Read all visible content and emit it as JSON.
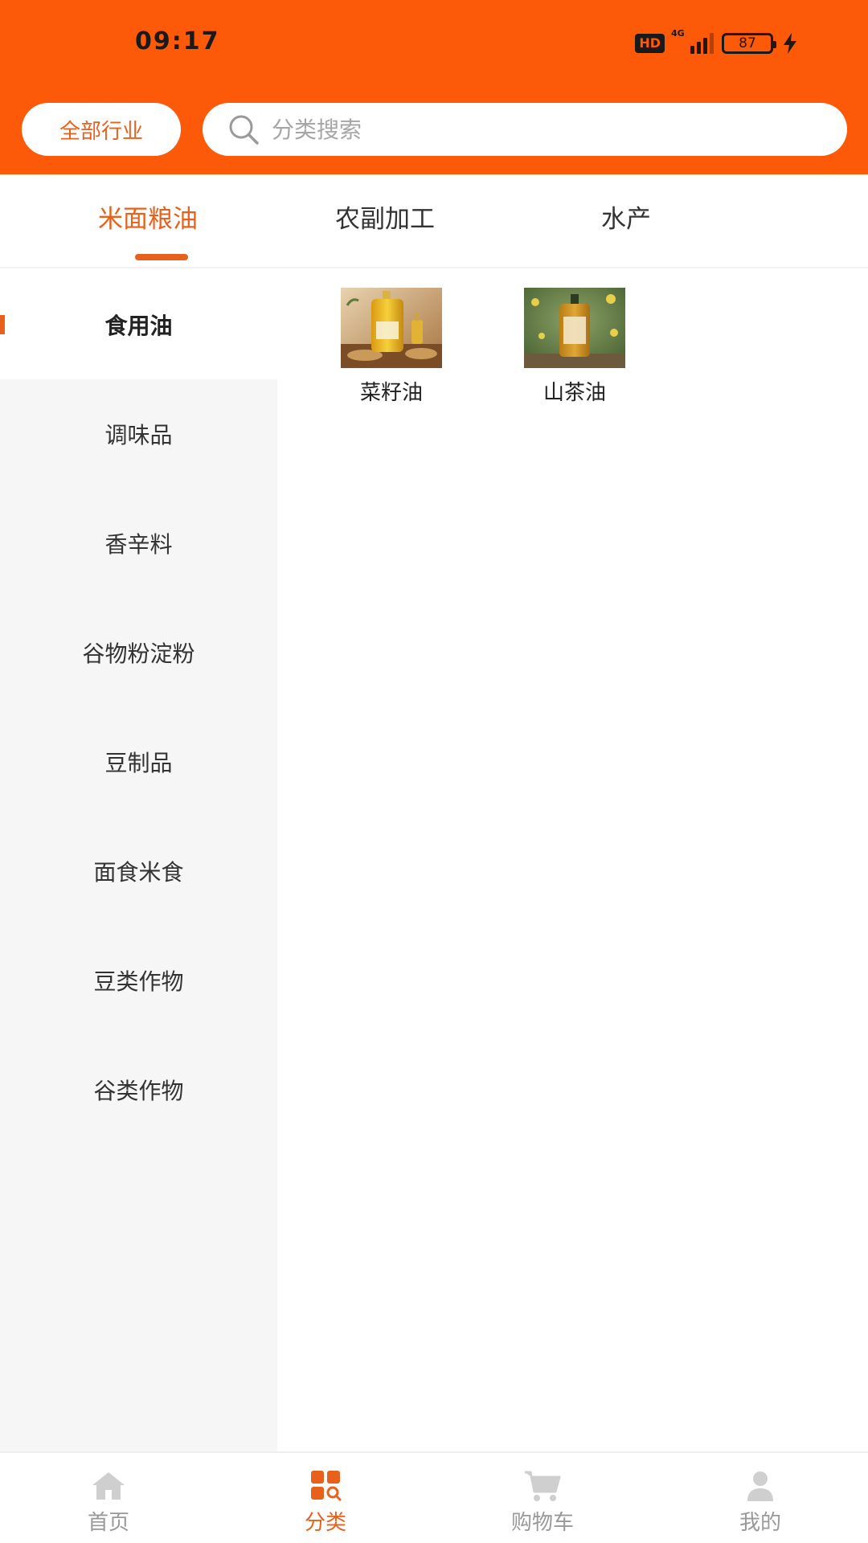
{
  "status_bar": {
    "time": "09:17",
    "hd": "HD",
    "network": "4G",
    "battery": "87"
  },
  "header": {
    "industry_button": "全部行业",
    "search_placeholder": "分类搜索"
  },
  "tabs": [
    {
      "label": "米面粮油",
      "active": true
    },
    {
      "label": "农副加工",
      "active": false
    },
    {
      "label": "水产",
      "active": false
    }
  ],
  "sidebar": {
    "items": [
      {
        "label": "食用油",
        "active": true
      },
      {
        "label": "调味品",
        "active": false
      },
      {
        "label": "香辛料",
        "active": false
      },
      {
        "label": "谷物粉淀粉",
        "active": false
      },
      {
        "label": "豆制品",
        "active": false
      },
      {
        "label": "面食米食",
        "active": false
      },
      {
        "label": "豆类作物",
        "active": false
      },
      {
        "label": "谷类作物",
        "active": false
      }
    ]
  },
  "products": [
    {
      "name": "菜籽油"
    },
    {
      "name": "山茶油"
    }
  ],
  "bottom_nav": [
    {
      "label": "首页",
      "icon": "home-icon",
      "active": false
    },
    {
      "label": "分类",
      "icon": "category-icon",
      "active": true
    },
    {
      "label": "购物车",
      "icon": "cart-icon",
      "active": false
    },
    {
      "label": "我的",
      "icon": "user-icon",
      "active": false
    }
  ],
  "colors": {
    "brand": "#fc5a08",
    "accent": "#e8611c",
    "sidebar_bg": "#f6f6f6"
  }
}
